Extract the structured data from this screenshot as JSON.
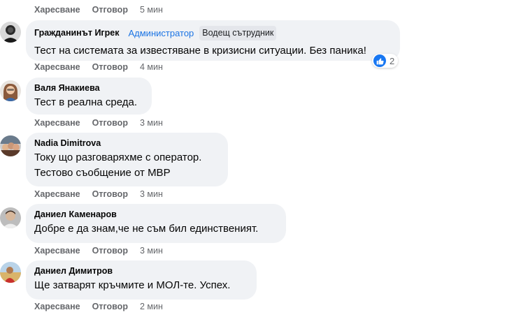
{
  "actions": {
    "like": "Харесване",
    "reply": "Отговор"
  },
  "top_time": "5 мин",
  "comments": [
    {
      "author": "Гражданинът Игрек",
      "admin_badge": "Администратор",
      "role_badge": "Водещ сътрудник",
      "lines": [
        "Тест на системата за известяване в кризисни ситуации. Без паника!"
      ],
      "time": "4 мин",
      "reaction_count": "2",
      "reaction_icon": "like-icon",
      "accent": "#1877f2"
    },
    {
      "author": "Валя Янакиева",
      "lines": [
        "Тест в реална среда."
      ],
      "time": "3 мин"
    },
    {
      "author": "Nadia Dimitrova",
      "lines": [
        "Току що разговаряхме с оператор.",
        "Тестово съобщение от МВР"
      ],
      "time": "3 мин"
    },
    {
      "author": "Даниел Каменаров",
      "lines": [
        "Добре е да знам,че не съм бил единственият."
      ],
      "time": "3 мин"
    },
    {
      "author": "Даниел Димитров",
      "lines": [
        "Ще затварят кръчмите и МОЛ-те. Успех."
      ],
      "time": "2 мин"
    }
  ]
}
